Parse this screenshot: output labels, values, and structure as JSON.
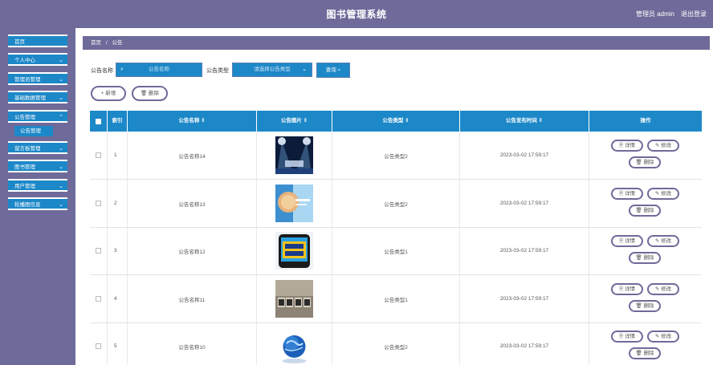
{
  "header": {
    "title": "图书管理系统",
    "user": "管理员 admin",
    "logout": "退出登录"
  },
  "sidebar": {
    "items": [
      {
        "label": "首页",
        "chevron": ""
      },
      {
        "label": "个人中心",
        "chevron": "⌄"
      },
      {
        "label": "管理员管理",
        "chevron": "⌄"
      },
      {
        "label": "基础数据管理",
        "chevron": "⌄"
      },
      {
        "label": "公告管理",
        "chevron": "⌃"
      },
      {
        "label": "留言板管理",
        "chevron": "⌄"
      },
      {
        "label": "图书管理",
        "chevron": "⌄"
      },
      {
        "label": "用户管理",
        "chevron": "⌄"
      },
      {
        "label": "轮播图信息",
        "chevron": "⌄"
      }
    ],
    "sub_active": "公告管理"
  },
  "breadcrumb": {
    "home": "首页",
    "sep": "/",
    "current": "公告"
  },
  "search": {
    "name_label": "公告名称",
    "name_placeholder": "公告名称",
    "type_label": "公告类型",
    "type_placeholder": "请选择公告类型",
    "query_label": "查询"
  },
  "actions": {
    "add": "新增",
    "delete": "删除"
  },
  "table": {
    "headers": [
      "",
      "索引",
      "公告名称",
      "公告图片",
      "公告类型",
      "公告发布时间",
      "操作"
    ],
    "sort_mark": "⇕",
    "detail": "详情",
    "edit": "修改",
    "remove": "删除",
    "rows": [
      {
        "index": "1",
        "name": "公告名称14",
        "type": "公告类型2",
        "time": "2023-03-02 17:59:17",
        "image": "stage-lights"
      },
      {
        "index": "2",
        "name": "公告名称13",
        "type": "公告类型2",
        "time": "2023-03-02 17:59:17",
        "image": "news-anchor"
      },
      {
        "index": "3",
        "name": "公告名称12",
        "type": "公告类型1",
        "time": "2023-03-02 17:59:17",
        "image": "hot-news-phone"
      },
      {
        "index": "4",
        "name": "公告名称11",
        "type": "公告类型1",
        "time": "2023-03-02 17:59:17",
        "image": "news-blocks"
      },
      {
        "index": "5",
        "name": "公告名称10",
        "type": "公告类型2",
        "time": "2023-03-02 17:59:17",
        "image": "globe"
      }
    ]
  },
  "colors": {
    "primary": "#1d88c8",
    "header": "#6e6a99"
  }
}
